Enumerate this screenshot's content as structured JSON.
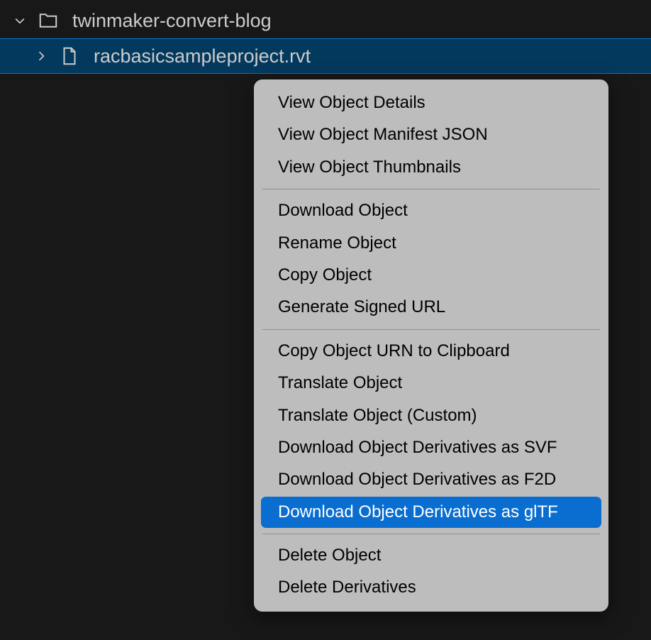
{
  "tree": {
    "folder": {
      "label": "twinmaker-convert-blog"
    },
    "file": {
      "label": "racbasicsampleproject.rvt"
    }
  },
  "menu": {
    "group1": [
      "View Object Details",
      "View Object Manifest JSON",
      "View Object Thumbnails"
    ],
    "group2": [
      "Download Object",
      "Rename Object",
      "Copy Object",
      "Generate Signed URL"
    ],
    "group3": [
      "Copy Object URN to Clipboard",
      "Translate Object",
      "Translate Object (Custom)",
      "Download Object Derivatives as SVF",
      "Download Object Derivatives as F2D",
      "Download Object Derivatives as glTF"
    ],
    "group4": [
      "Delete Object",
      "Delete Derivatives"
    ],
    "highlight": "Download Object Derivatives as glTF"
  }
}
